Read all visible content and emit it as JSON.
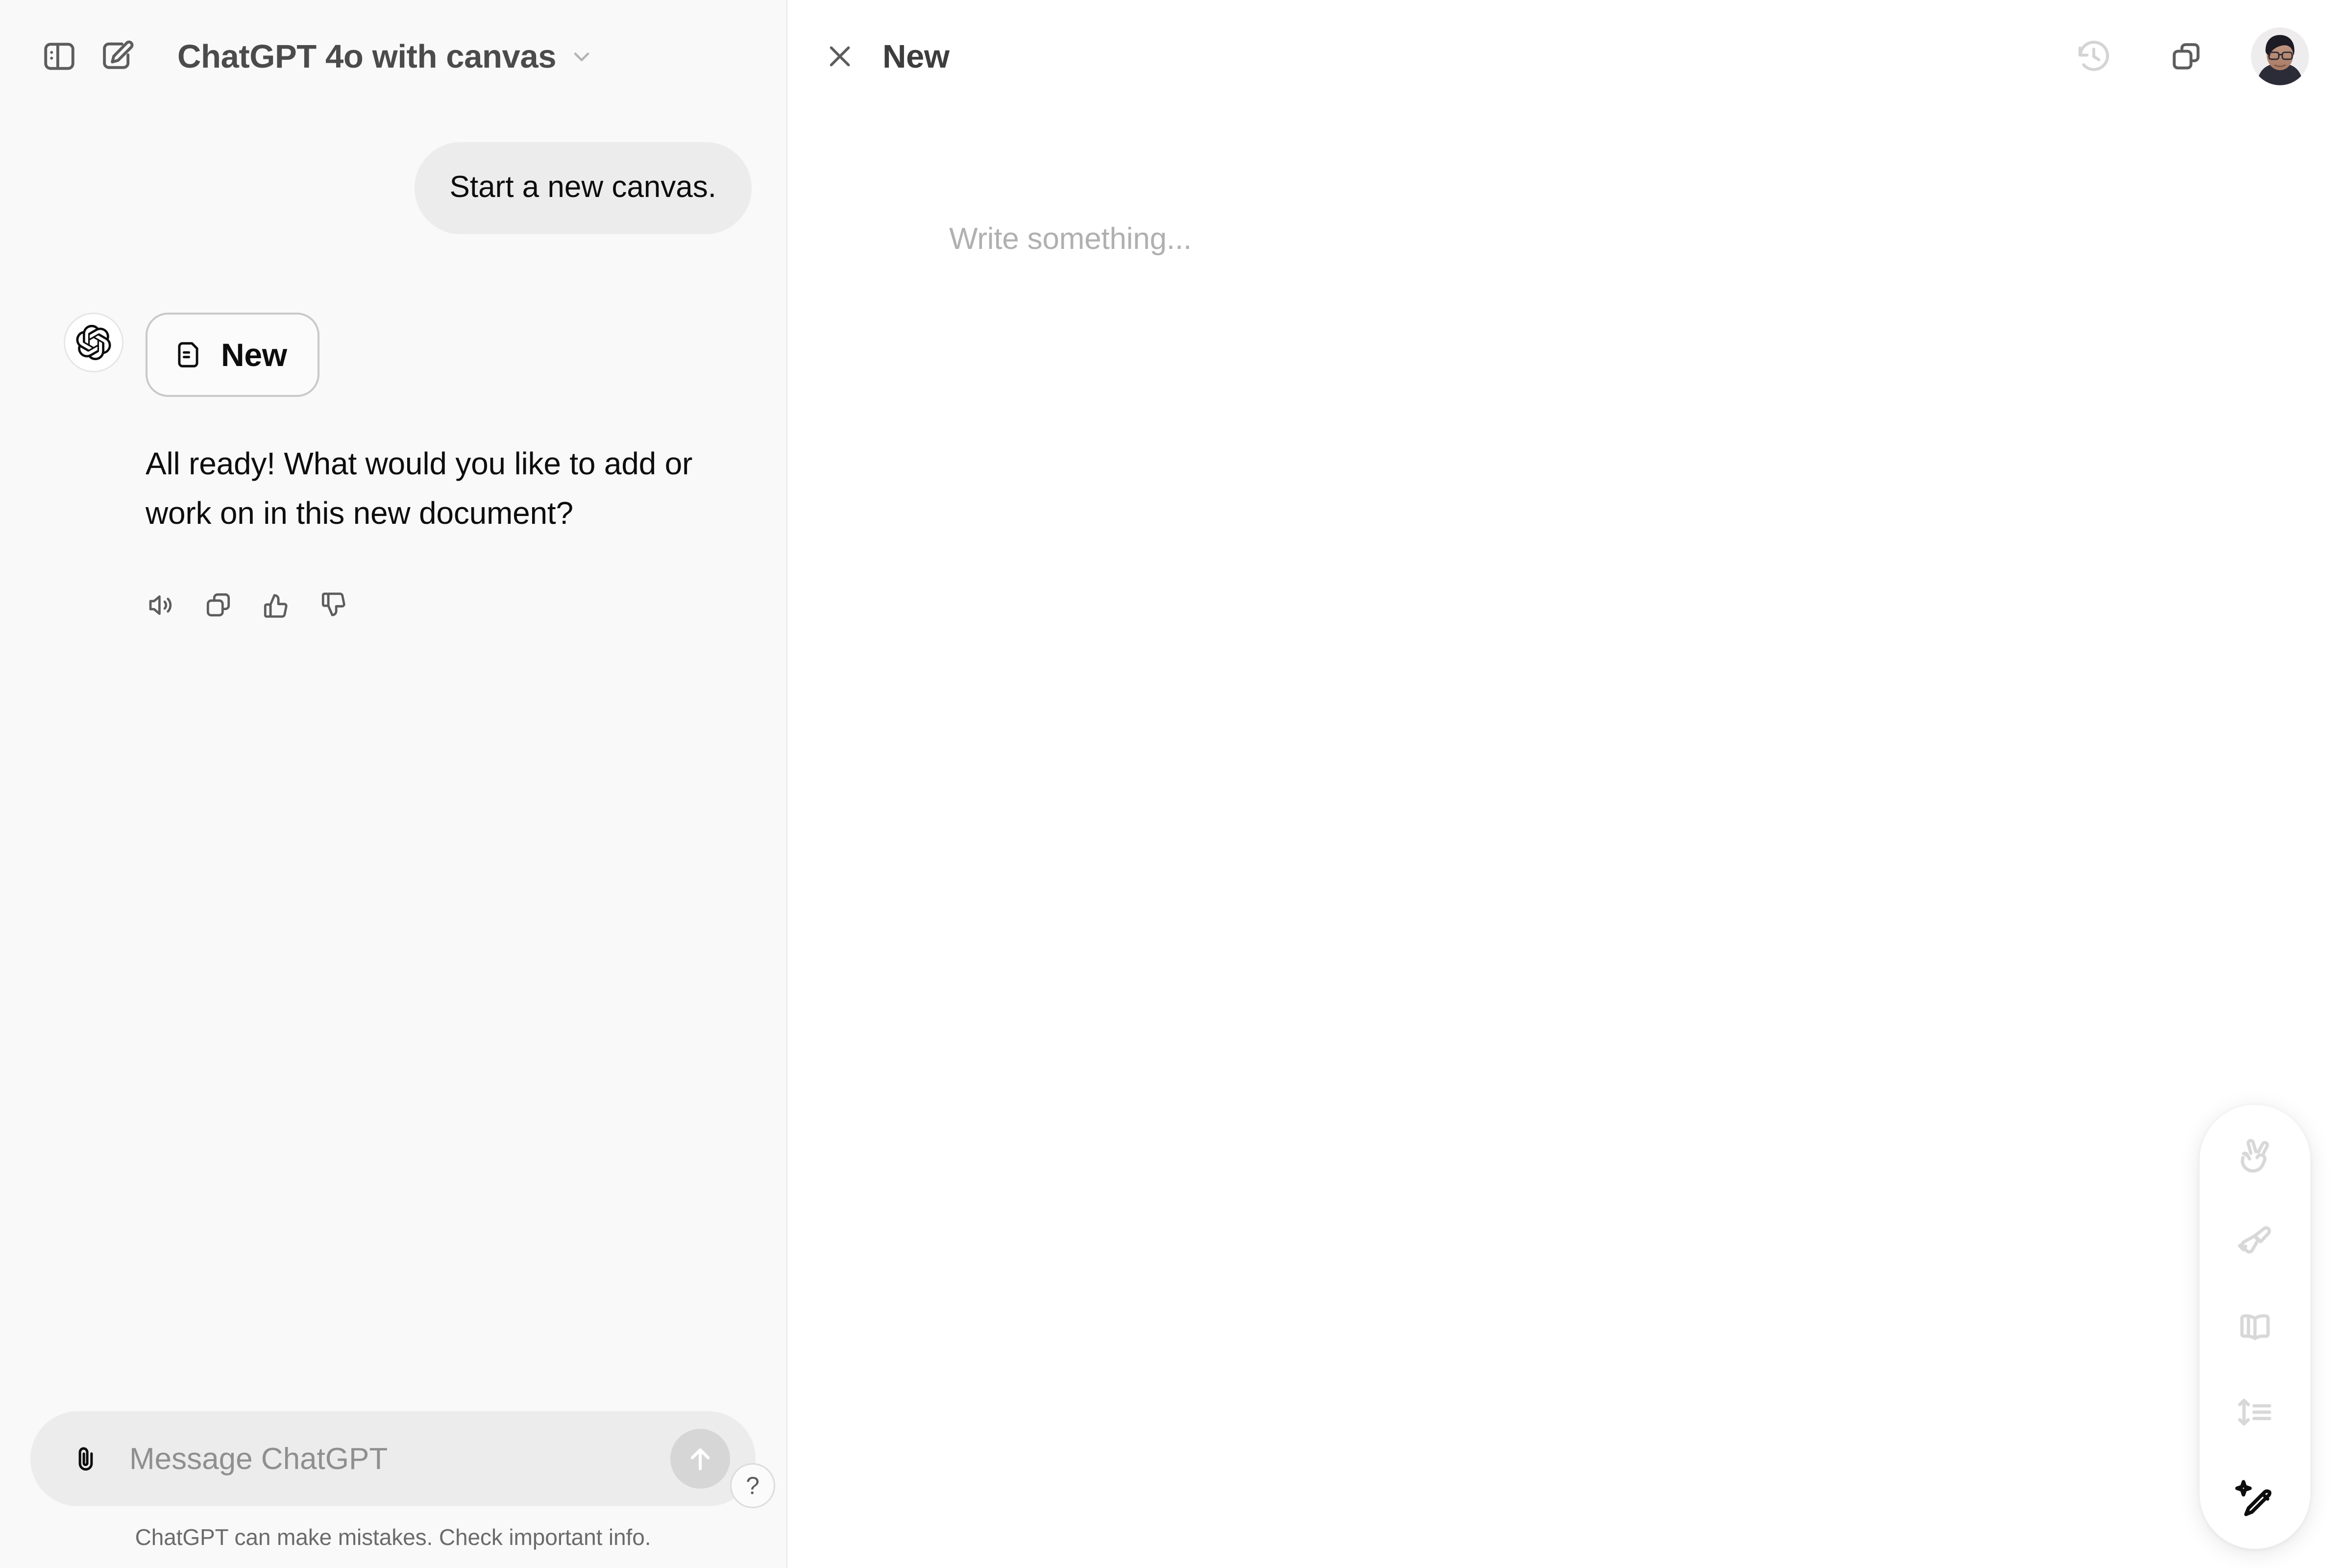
{
  "sidebar_panel": {
    "toggle_sidebar_label": "Toggle sidebar",
    "new_chat_label": "New chat",
    "model_name": "ChatGPT 4o with canvas"
  },
  "conversation": {
    "user_message": "Start a new canvas.",
    "assistant_doc_card_label": "New",
    "assistant_message": "All ready! What would you like to add or work on in this new document?",
    "actions": [
      {
        "name": "read-aloud",
        "label": "Read aloud"
      },
      {
        "name": "copy",
        "label": "Copy"
      },
      {
        "name": "thumbs-up",
        "label": "Good response"
      },
      {
        "name": "thumbs-down",
        "label": "Bad response"
      }
    ]
  },
  "composer": {
    "placeholder": "Message ChatGPT",
    "value": "",
    "attach_label": "Attach file",
    "send_label": "Send message",
    "disclaimer": "ChatGPT can make mistakes. Check important info.",
    "help_label": "?"
  },
  "canvas": {
    "close_label": "Close canvas",
    "title": "New",
    "placeholder": "Write something...",
    "history_label": "Show version history",
    "copy_label": "Copy to clipboard",
    "account_label": "Account"
  },
  "canvas_toolbar": {
    "items": [
      {
        "name": "add-emojis",
        "label": "Add emojis",
        "active": false
      },
      {
        "name": "polish",
        "label": "Add final polish",
        "active": false
      },
      {
        "name": "reading-level",
        "label": "Reading level",
        "active": false
      },
      {
        "name": "adjust-length",
        "label": "Adjust the length",
        "active": false
      },
      {
        "name": "suggest-edits",
        "label": "Suggest edits",
        "active": true
      }
    ]
  },
  "colors": {
    "panel_bg": "#f9f9f9",
    "canvas_bg": "#ffffff",
    "bubble_bg": "#ececec",
    "composer_bg": "#ececec",
    "text_primary": "#0d0d0d",
    "text_muted": "#8f8f8f",
    "icon_default": "#5d5d5d",
    "icon_disabled": "#d4d4d4",
    "divider": "#ececec"
  }
}
